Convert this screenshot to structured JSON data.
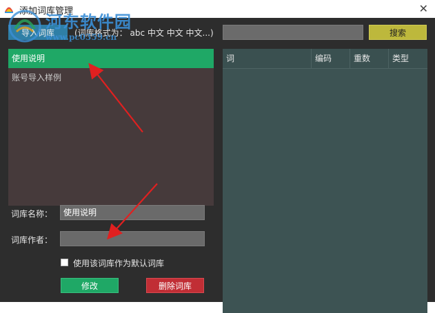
{
  "window": {
    "title": "添加词库管理",
    "close_glyph": "✕"
  },
  "watermark": {
    "text": "河东软件园",
    "url": "www.pc0359.cn"
  },
  "toolbar": {
    "import_label": "导入词库",
    "format_hint": "(词库格式为： abc 中文 中文 中文...)",
    "search_value": "",
    "search_label": "搜索"
  },
  "library_list": {
    "items": [
      {
        "label": "使用说明",
        "selected": true
      },
      {
        "label": "账号导入样例",
        "selected": false
      }
    ]
  },
  "word_table": {
    "columns": [
      "词",
      "编码",
      "重数",
      "类型"
    ],
    "rows": []
  },
  "form": {
    "name_label": "词库名称：",
    "name_value": "使用说明",
    "author_label": "词库作者：",
    "author_value": "",
    "default_checkbox_label": "使用该词库作为默认词库",
    "default_checked": false,
    "edit_label": "修改",
    "delete_label": "删除词库"
  },
  "colors": {
    "background": "#2d2d2d",
    "accent_green": "#1fa866",
    "accent_red": "#c12e35",
    "search_yellow": "#bdb83c",
    "import_blue": "#2f7fa6",
    "annotation_arrow": "#e02020"
  }
}
